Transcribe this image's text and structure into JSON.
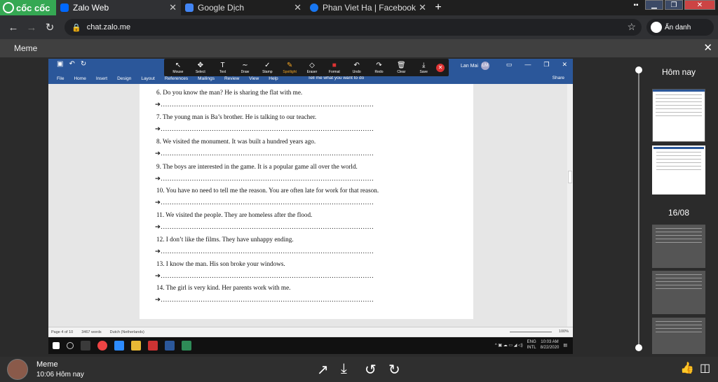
{
  "browser": {
    "brand": "cốc cốc",
    "tabs": [
      {
        "title": "Zalo Web",
        "color": "#0068ff"
      },
      {
        "title": "Google Dịch",
        "color": "#4285f4"
      },
      {
        "title": "Phan Viet Ha | Facebook",
        "color": "#1877f2"
      }
    ],
    "new_tab": "+",
    "url": "chat.zalo.me",
    "incognito_label": "Ẩn danh"
  },
  "viewer": {
    "title": "Meme",
    "close": "✕"
  },
  "word": {
    "user": "Lan Mai",
    "user_initials": "LM",
    "ribbon_tabs": [
      "File",
      "Home",
      "Insert",
      "Design",
      "Layout",
      "References",
      "Mailings",
      "Review",
      "View",
      "Help"
    ],
    "tell_me": "Tell me what you want to do",
    "share": "Share",
    "annotation_tools": [
      {
        "label": "Mouse",
        "icon": "cursor-icon",
        "glyph": "↖"
      },
      {
        "label": "Select",
        "icon": "move-icon",
        "glyph": "✥"
      },
      {
        "label": "Text",
        "icon": "text-icon",
        "glyph": "T"
      },
      {
        "label": "Draw",
        "icon": "draw-icon",
        "glyph": "∼"
      },
      {
        "label": "Stamp",
        "icon": "stamp-icon",
        "glyph": "✓"
      },
      {
        "label": "Spotlight",
        "icon": "spotlight-icon",
        "glyph": "✎"
      },
      {
        "label": "Eraser",
        "icon": "eraser-icon",
        "glyph": "◇"
      },
      {
        "label": "Format",
        "icon": "format-icon",
        "glyph": "■"
      },
      {
        "label": "Undo",
        "icon": "undo-icon",
        "glyph": "↶"
      },
      {
        "label": "Redo",
        "icon": "redo-icon",
        "glyph": "↷"
      },
      {
        "label": "Clear",
        "icon": "trash-icon",
        "glyph": "🗑"
      },
      {
        "label": "Save",
        "icon": "save-icon",
        "glyph": "⤓"
      }
    ],
    "questions": [
      "6. Do you know the man? He is sharing the flat with me.",
      "7. The young man is Ba’s brother. He is talking to our teacher.",
      "8. We visited the monument. It was built a hundred years ago.",
      "9. The boys are interested in the game. It is a popular game all over the world.",
      "10. You have no need to tell me the reason. You are often late for work for that reason.",
      "11. We visited the people. They are homeless after the flood.",
      "12. I don’t like the films. They have unhappy ending.",
      "13. I know the man. His son broke your windows.",
      "14. The girl is very kind. Her parents work with me."
    ],
    "answer_line": "➔……………………………………………………………………………………",
    "status": {
      "page": "Page 4 of 10",
      "words": "3467 words",
      "language": "Dutch (Netherlands)",
      "zoom": "100%"
    },
    "tray": {
      "lang_top": "ENG",
      "lang_bottom": "INTL",
      "time": "10:03 AM",
      "date": "8/22/2020"
    }
  },
  "timeline": {
    "today": "Hôm nay",
    "date": "16/08"
  },
  "bottom": {
    "sender": "Meme",
    "time": "10:06 Hôm nay"
  }
}
